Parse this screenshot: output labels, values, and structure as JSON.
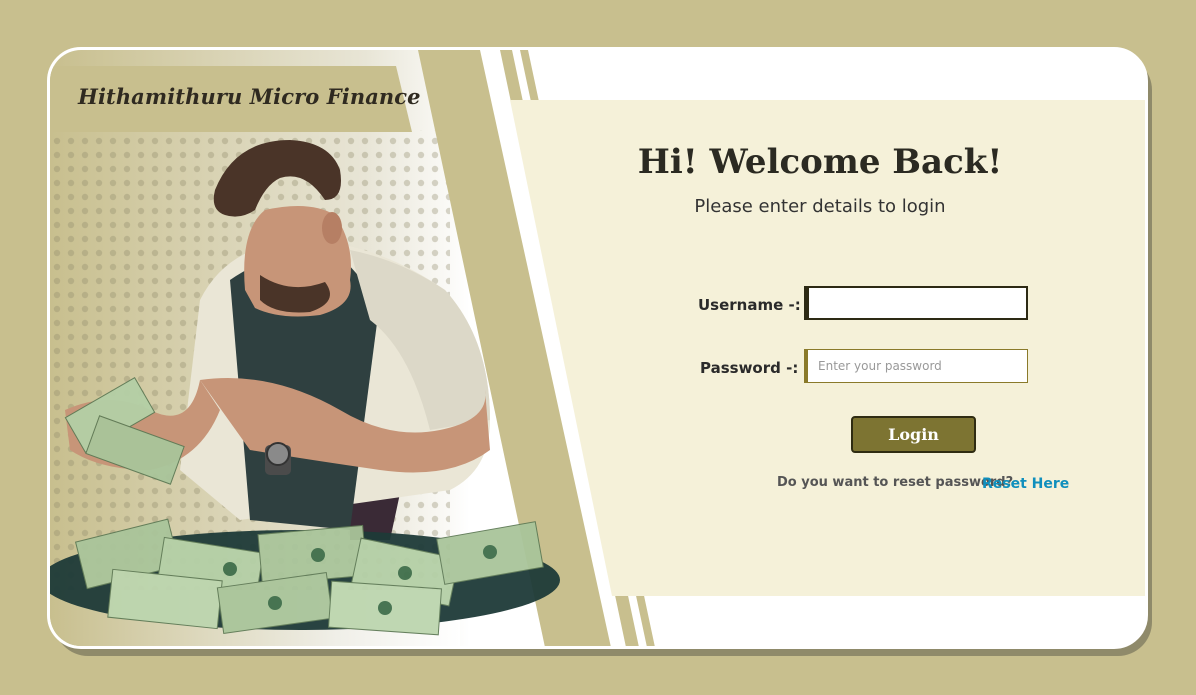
{
  "brand": {
    "name": "Hithamithuru Micro Finance"
  },
  "login": {
    "title": "Hi! Welcome Back!",
    "subtitle": "Please enter details to login",
    "username_label": "Username -:",
    "username_value": "",
    "password_label": "Password -:",
    "password_placeholder": "Enter your password",
    "login_button": "Login",
    "reset_prompt": "Do you want to reset password?",
    "reset_link": "Reset Here"
  },
  "colors": {
    "background": "#c8bf8e",
    "panel": "#f5f1d9",
    "button": "#7d7432",
    "link": "#0f8fbd"
  },
  "illustration": {
    "icon": "man-counting-money-illustration"
  }
}
